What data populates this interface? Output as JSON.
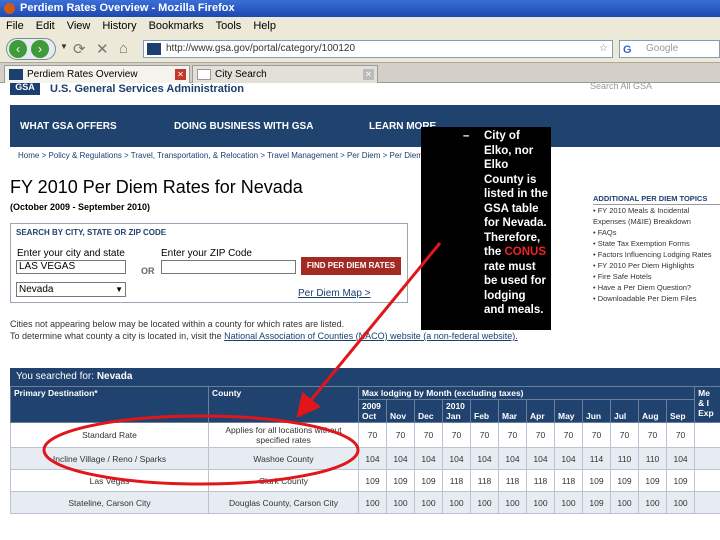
{
  "window": {
    "title": "Perdiem Rates Overview - Mozilla Firefox"
  },
  "menu": [
    "File",
    "Edit",
    "View",
    "History",
    "Bookmarks",
    "Tools",
    "Help"
  ],
  "nav": {
    "url": "http://www.gsa.gov/portal/category/100120",
    "search_placeholder": "Google"
  },
  "tabs": [
    {
      "label": "Perdiem Rates Overview",
      "active": true
    },
    {
      "label": "City Search",
      "active": false
    }
  ],
  "page": {
    "logo": "GSA",
    "agency": "U.S. General Services Administration",
    "top_search_label": "Search",
    "top_search_value": "All GSA",
    "nav_items": [
      "WHAT GSA OFFERS",
      "DOING BUSINESS WITH GSA",
      "LEARN MORE"
    ],
    "breadcrumb": "Home > Policy & Regulations > Travel, Transportation, & Relocation > Travel Management > Per Diem > Per Diem Rates",
    "title": "FY 2010 Per Diem Rates for Nevada",
    "subtitle": "(October 2009 - September 2010)",
    "search": {
      "header": "SEARCH BY CITY, STATE OR ZIP CODE",
      "city_label": "Enter your city and state",
      "zip_label": "Enter your ZIP Code",
      "city_value": "LAS VEGAS",
      "or": "OR",
      "button": "FIND PER DIEM RATES",
      "state_value": "Nevada",
      "map_link": "Per Diem Map >"
    },
    "cities_note": "Cities not appearing below may be located within a county for which rates are listed.",
    "county_note_pre": "To determine what county a city is located in, visit the ",
    "county_note_link": "National Association of Counties (NACO) website (a non-federal website).",
    "right": {
      "header": "ADDITIONAL PER DIEM TOPICS",
      "items": [
        "FY 2010 Meals & Incidental Expenses (M&IE) Breakdown",
        "FAQs",
        "State Tax Exemption Forms",
        "Factors Influencing Lodging Rates",
        "FY 2010 Per Diem Highlights",
        "Fire Safe Hotels",
        "Have a Per Diem Question?",
        "Downloadable Per Diem Files"
      ]
    },
    "you_searched_label": "You searched for:",
    "you_searched_value": "Nevada",
    "table": {
      "col_dest": "Primary Destination*",
      "col_county": "County",
      "max_header": "Max lodging by Month (excluding taxes)",
      "meals_header": "Meals & Incidentals",
      "meals_short": "Me & I Exp",
      "year1": "2009",
      "year2": "2010",
      "months": [
        "Oct",
        "Nov",
        "Dec",
        "Jan",
        "Feb",
        "Mar",
        "Apr",
        "May",
        "Jun",
        "Jul",
        "Aug",
        "Sep"
      ],
      "rows": [
        {
          "dest": "Standard Rate",
          "county": "Applies for all locations without specified rates",
          "rates": [
            "70",
            "70",
            "70",
            "70",
            "70",
            "70",
            "70",
            "70",
            "70",
            "70",
            "70",
            "70"
          ],
          "mie": ""
        },
        {
          "dest": "Incline Village / Reno / Sparks",
          "county": "Washoe County",
          "rates": [
            "104",
            "104",
            "104",
            "104",
            "104",
            "104",
            "104",
            "104",
            "114",
            "110",
            "110",
            "104"
          ],
          "mie": ""
        },
        {
          "dest": "Las Vegas",
          "county": "Clark County",
          "rates": [
            "109",
            "109",
            "109",
            "118",
            "118",
            "118",
            "118",
            "118",
            "109",
            "109",
            "109",
            "109"
          ],
          "mie": ""
        },
        {
          "dest": "Stateline, Carson City",
          "county": "Douglas County, Carson City",
          "rates": [
            "100",
            "100",
            "100",
            "100",
            "100",
            "100",
            "100",
            "100",
            "109",
            "100",
            "100",
            "100"
          ],
          "mie": ""
        }
      ]
    }
  },
  "callout": {
    "dash": "–",
    "pre": "City of Elko, nor Elko County is listed in the GSA table for Nevada. Therefore, the ",
    "conus": "CONUS",
    "post": " rate must be used for lodging and meals."
  },
  "colors": {
    "annotation": "#e0161b",
    "gsa_navy": "#20426f"
  }
}
